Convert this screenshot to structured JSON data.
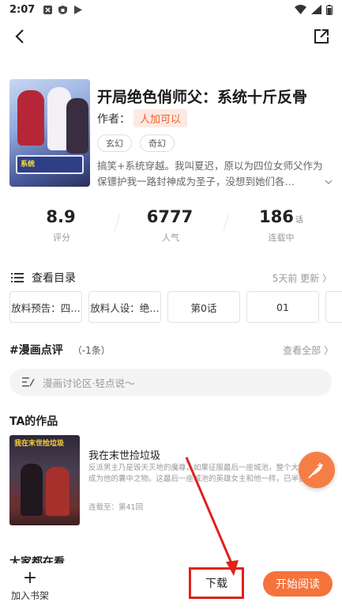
{
  "status_bar": {
    "time": "2:07"
  },
  "comic": {
    "title": "开局绝色俏师父：系统十斤反骨",
    "author_label": "作者：",
    "author_name": "人加可以",
    "genres": [
      "玄幻",
      "奇幻"
    ],
    "description": "搞笑+系统穿越。我叫夏迟，原以为四位女师父作为保镖护我一路封神成为圣子，没想到她们各…",
    "cover_logo_text": "系统"
  },
  "stats": [
    {
      "value": "8.9",
      "unit": "",
      "label": "评分"
    },
    {
      "value": "6777",
      "unit": "",
      "label": "人气"
    },
    {
      "value": "186",
      "unit": "话",
      "label": "连载中"
    }
  ],
  "catalog": {
    "label": "查看目录",
    "update": "5天前 更新 〉",
    "chapters": [
      "放料预告：四…",
      "放料人设：绝…",
      "第0话",
      "01",
      ""
    ]
  },
  "reviews": {
    "title": "#漫画点评",
    "count": "（-1条）",
    "view_all": "查看全部 〉",
    "input_placeholder": "漫画讨论区·轻点说～"
  },
  "works": {
    "heading": "TA的作品",
    "item": {
      "title": "我在末世捡垃圾",
      "cover_text": "我在末世捡垃圾",
      "desc": "反派男主乃是毁天灭地的魔尊，如果征服最后一座城池，整个大陆都将成为他的囊中之物。这最后一座城池的英雄女主和他一样，已半步成…",
      "status": "连载至：第41回"
    }
  },
  "next_section": "大家都在看",
  "bottom": {
    "shelf_label": "加入书架",
    "download_label": "下载",
    "read_label": "开始阅读"
  },
  "colors": {
    "accent": "#f4733a",
    "annotation": "#e0221b",
    "tag_bg": "#fde9e2"
  }
}
